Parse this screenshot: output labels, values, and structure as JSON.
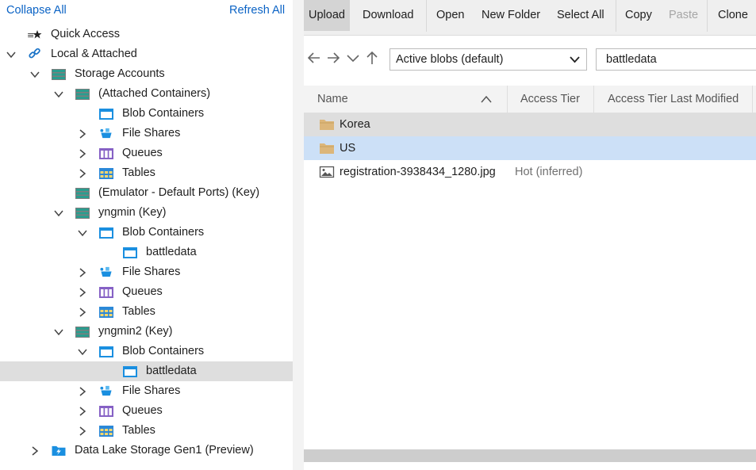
{
  "explorer": {
    "collapse_all": "Collapse All",
    "refresh_all": "Refresh All",
    "tree": {
      "quick_access": "Quick Access",
      "local_attached": "Local & Attached",
      "storage_accounts": "Storage Accounts",
      "attached_containers": "(Attached Containers)",
      "ac_blob": "Blob Containers",
      "ac_files": "File Shares",
      "ac_queues": "Queues",
      "ac_tables": "Tables",
      "emulator": "(Emulator - Default Ports) (Key)",
      "yngmin": "yngmin (Key)",
      "y1_blob": "Blob Containers",
      "y1_battledata": "battledata",
      "y1_files": "File Shares",
      "y1_queues": "Queues",
      "y1_tables": "Tables",
      "yngmin2": "yngmin2 (Key)",
      "y2_blob": "Blob Containers",
      "y2_battledata": "battledata",
      "y2_files": "File Shares",
      "y2_queues": "Queues",
      "y2_tables": "Tables",
      "data_lake": "Data Lake Storage Gen1 (Preview)"
    }
  },
  "toolbar": {
    "upload": "Upload",
    "download": "Download",
    "open": "Open",
    "new_folder": "New Folder",
    "select_all": "Select All",
    "copy": "Copy",
    "paste": "Paste",
    "clone": "Clone"
  },
  "navigation": {
    "view_selected": "Active blobs (default)",
    "path_value": "battledata"
  },
  "grid": {
    "columns": {
      "name": "Name",
      "access_tier": "Access Tier",
      "access_tier_last_modified": "Access Tier Last Modified"
    },
    "rows": [
      {
        "name": "Korea",
        "access_tier": "",
        "kind": "folder"
      },
      {
        "name": "US",
        "access_tier": "",
        "kind": "folder"
      },
      {
        "name": "registration-3938434_1280.jpg",
        "access_tier": "Hot (inferred)",
        "kind": "image"
      }
    ]
  },
  "colors": {
    "link": "#0b63c5",
    "selected_row": "#cce0f7",
    "hover_row": "#dedede",
    "folder": "#dcb67a",
    "storage_icon": "#2a9d8f",
    "blob_icon": "#1a8fe0",
    "queue_icon": "#8661c5",
    "table_icon": "#2b88d8"
  }
}
